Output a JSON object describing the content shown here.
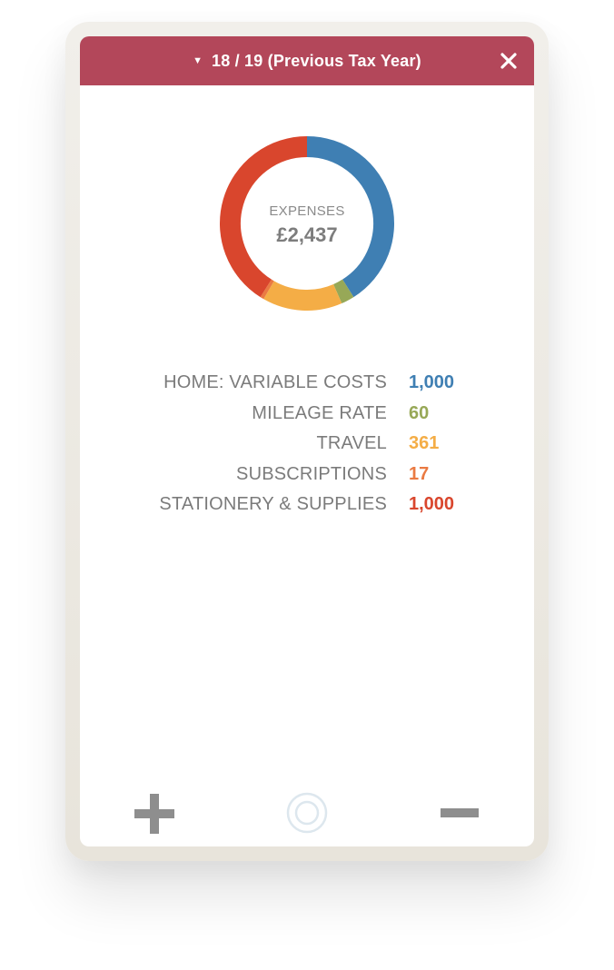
{
  "header": {
    "year_label": "18 / 19 (Previous Tax Year)",
    "caret_icon": "triangle-down-icon",
    "close_icon": "close-icon",
    "bg_color": "#b3475a"
  },
  "summary": {
    "label": "EXPENSES",
    "total": "£2,437"
  },
  "chart_data": {
    "type": "pie",
    "style": "donut",
    "categories": [
      "HOME: VARIABLE COSTS",
      "MILEAGE RATE",
      "TRAVEL",
      "SUBSCRIPTIONS",
      "STATIONERY & SUPPLIES"
    ],
    "values": [
      1000,
      60,
      361,
      17,
      1000
    ],
    "colors": [
      "#3f7fb3",
      "#97a857",
      "#f4ad46",
      "#ea7a42",
      "#d9462d"
    ]
  },
  "legend": [
    {
      "name": "HOME: VARIABLE COSTS",
      "value": "1,000",
      "color": "#3f7fb3"
    },
    {
      "name": "MILEAGE RATE",
      "value": "60",
      "color": "#97a857"
    },
    {
      "name": "TRAVEL",
      "value": "361",
      "color": "#f4ad46"
    },
    {
      "name": "SUBSCRIPTIONS",
      "value": "17",
      "color": "#ea7a42"
    },
    {
      "name": "STATIONERY & SUPPLIES",
      "value": "1,000",
      "color": "#d9462d"
    }
  ],
  "toolbar": {
    "add_icon": "plus-icon",
    "center_icon": "target-icon",
    "remove_icon": "minus-icon"
  }
}
